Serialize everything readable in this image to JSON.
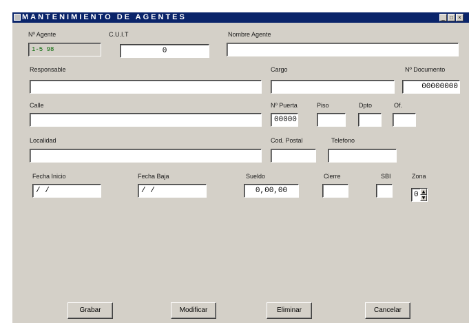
{
  "window": {
    "title": "MANTENIMIENTO DE AGENTES",
    "controls": [
      "_",
      "□",
      "×"
    ]
  },
  "fields": {
    "num_agente": {
      "label": "Nº Agente",
      "value": "1-5 98"
    },
    "cuit": {
      "label": "C.U.I.T",
      "value": "0"
    },
    "nombre_agente": {
      "label": "Nombre Agente",
      "value": ""
    },
    "responsable": {
      "label": "Responsable",
      "value": ""
    },
    "cargo": {
      "label": "Cargo",
      "value": ""
    },
    "num_documento": {
      "label": "Nº Documento",
      "value": "00000000"
    },
    "calle": {
      "label": "Calle",
      "value": ""
    },
    "num_puerta": {
      "label": "Nº Puerta",
      "value": "00000"
    },
    "piso": {
      "label": "Piso",
      "value": ""
    },
    "dpto": {
      "label": "Dpto",
      "value": ""
    },
    "of": {
      "label": "Of.",
      "value": ""
    },
    "localidad": {
      "label": "Localidad",
      "value": ""
    },
    "cod_postal": {
      "label": "Cod. Postal",
      "value": ""
    },
    "telefono": {
      "label": "Telefono",
      "value": ""
    },
    "fecha_inicio": {
      "label": "Fecha Inicio",
      "value": "/ /"
    },
    "fecha_baja": {
      "label": "Fecha Baja",
      "value": "/ /"
    },
    "sueldo": {
      "label": "Sueldo",
      "value": "0,00,00"
    },
    "cierre": {
      "label": "Cierre",
      "value": ""
    },
    "sbi": {
      "label": "SBI",
      "value": ""
    },
    "zona": {
      "label": "Zona",
      "value": "0"
    }
  },
  "spin": {
    "up": "▲",
    "down": "▼"
  },
  "buttons": {
    "grabar": "Grabar",
    "modificar": "Modificar",
    "eliminar": "Eliminar",
    "cancelar": "Cancelar"
  }
}
